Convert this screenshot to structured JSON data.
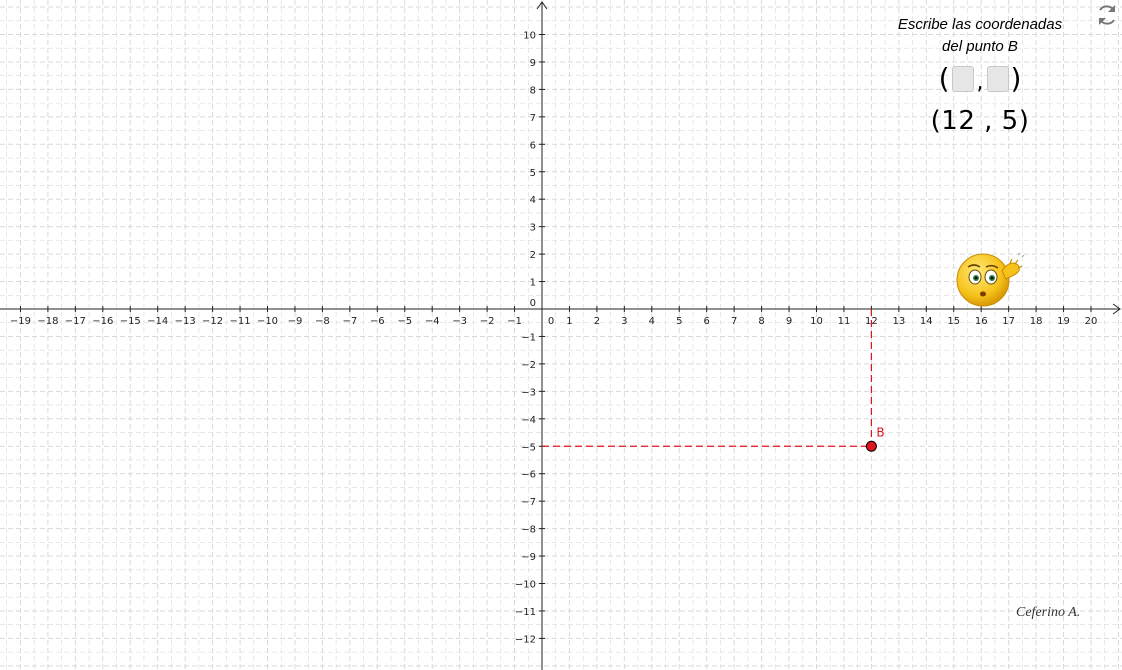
{
  "prompt": {
    "line1": "Escribe las coordenadas",
    "line2": "del punto B"
  },
  "inputs": {
    "open_paren": "(",
    "separator": ",",
    "close_paren": ")",
    "x_value": "",
    "y_value": ""
  },
  "answer": {
    "text": "(12 , 5)"
  },
  "point": {
    "label": "B",
    "x": 12,
    "y": -5,
    "color": "#e0141e"
  },
  "axes": {
    "x_range": [
      -19,
      20
    ],
    "y_range": [
      -12,
      10
    ],
    "grid": true,
    "grid_color": "#d9d9d9"
  },
  "credit": "Ceferino A.",
  "icons": {
    "reset": "reset-icon",
    "emoji": "confused-face-icon"
  }
}
